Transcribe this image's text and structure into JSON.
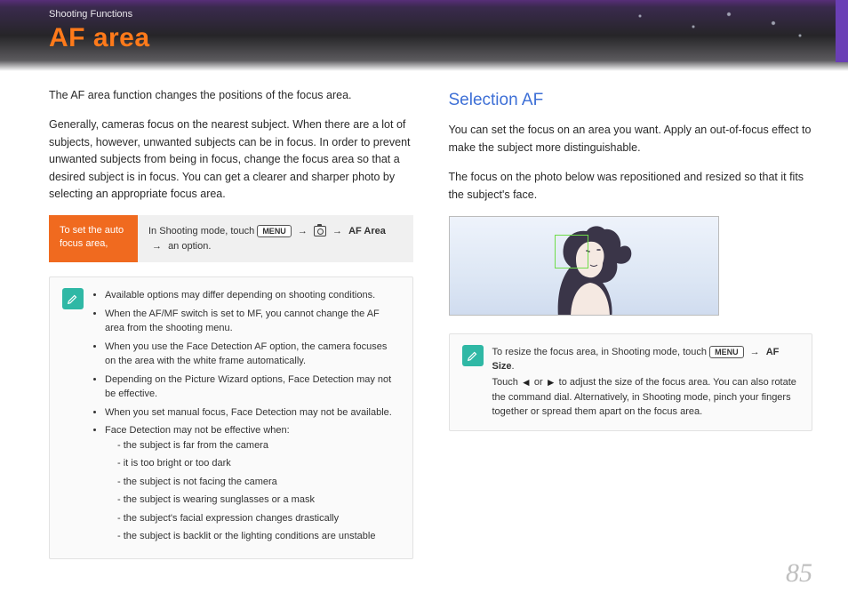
{
  "header": {
    "breadcrumb": "Shooting Functions",
    "title": "AF area"
  },
  "left": {
    "p1": "The AF area function changes the positions of the focus area.",
    "p2": "Generally, cameras focus on the nearest subject. When there are a lot of subjects, however, unwanted subjects can be in focus. In order to prevent unwanted subjects from being in focus, change the focus area so that a desired subject is in focus. You can get a clearer and sharper photo by selecting an appropriate focus area.",
    "instr_label": "To set the auto focus area,",
    "instr_lead": "In Shooting mode, touch ",
    "instr_menu": "MENU",
    "instr_afarea": "AF Area",
    "instr_tail": "an option.",
    "notes": [
      "Available options may differ depending on shooting conditions.",
      "When the AF/MF switch is set to MF, you cannot change the AF area from the shooting menu.",
      "When you use the Face Detection AF option, the camera focuses on the area with the white frame automatically.",
      "Depending on the Picture Wizard options, Face Detection may not be effective.",
      "When you set manual focus, Face Detection may not be available.",
      "Face Detection may not be effective when:"
    ],
    "sub": [
      "the subject is far from the camera",
      "it is too bright or too dark",
      "the subject is not facing the camera",
      "the subject is wearing sunglasses or a mask",
      "the subject's facial expression changes drastically",
      "the subject is backlit or the lighting conditions are unstable"
    ]
  },
  "right": {
    "heading": "Selection AF",
    "p1": "You can set the focus on an area you want. Apply an out-of-focus effect to make the subject more distinguishable.",
    "p2": "The focus on the photo below was repositioned and resized so that it fits the subject's face.",
    "note1": "To resize the focus area, in Shooting mode, touch ",
    "note_menu": "MENU",
    "note_afsize": "AF Size",
    "note2": "Touch ",
    "note3": " or ",
    "note4": " to adjust the size of the focus area. You can also rotate the command dial. Alternatively, in Shooting mode, pinch your fingers together or spread them apart on the focus area."
  },
  "page": "85"
}
